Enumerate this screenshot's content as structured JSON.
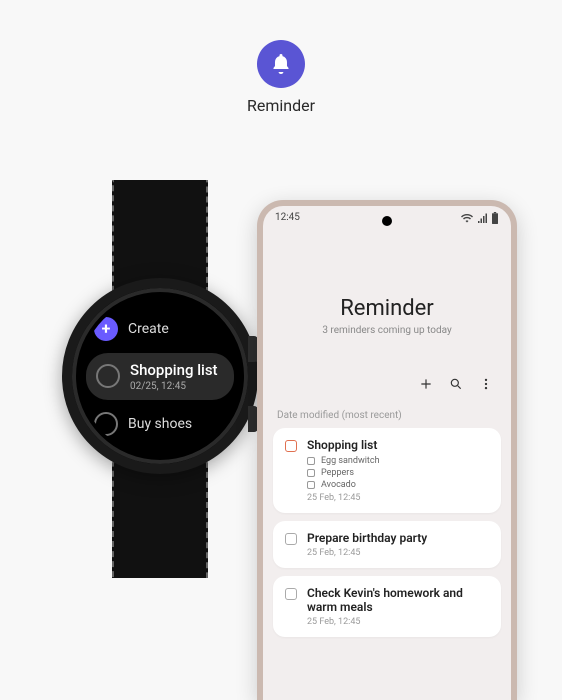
{
  "header": {
    "label": "Reminder"
  },
  "watch": {
    "create_label": "Create",
    "selected": {
      "title": "Shopping list",
      "sub": "02/25, 12:45"
    },
    "next_label": "Buy shoes"
  },
  "phone": {
    "status": {
      "time": "12:45",
      "wifi": "wifi",
      "signal": "signal",
      "battery": "battery"
    },
    "title": "Reminder",
    "subtitle": "3 reminders coming up today",
    "section_label": "Date modified (most recent)",
    "reminders": [
      {
        "title": "Shopping list",
        "date": "25 Feb, 12:45",
        "accent": true,
        "subitems": [
          "Egg sandwitch",
          "Peppers",
          "Avocado"
        ]
      },
      {
        "title": "Prepare birthday party",
        "date": "25 Feb, 12:45",
        "accent": false,
        "subitems": []
      },
      {
        "title": "Check Kevin's homework and warm meals",
        "date": "25 Feb, 12:45",
        "accent": false,
        "subitems": []
      }
    ]
  }
}
